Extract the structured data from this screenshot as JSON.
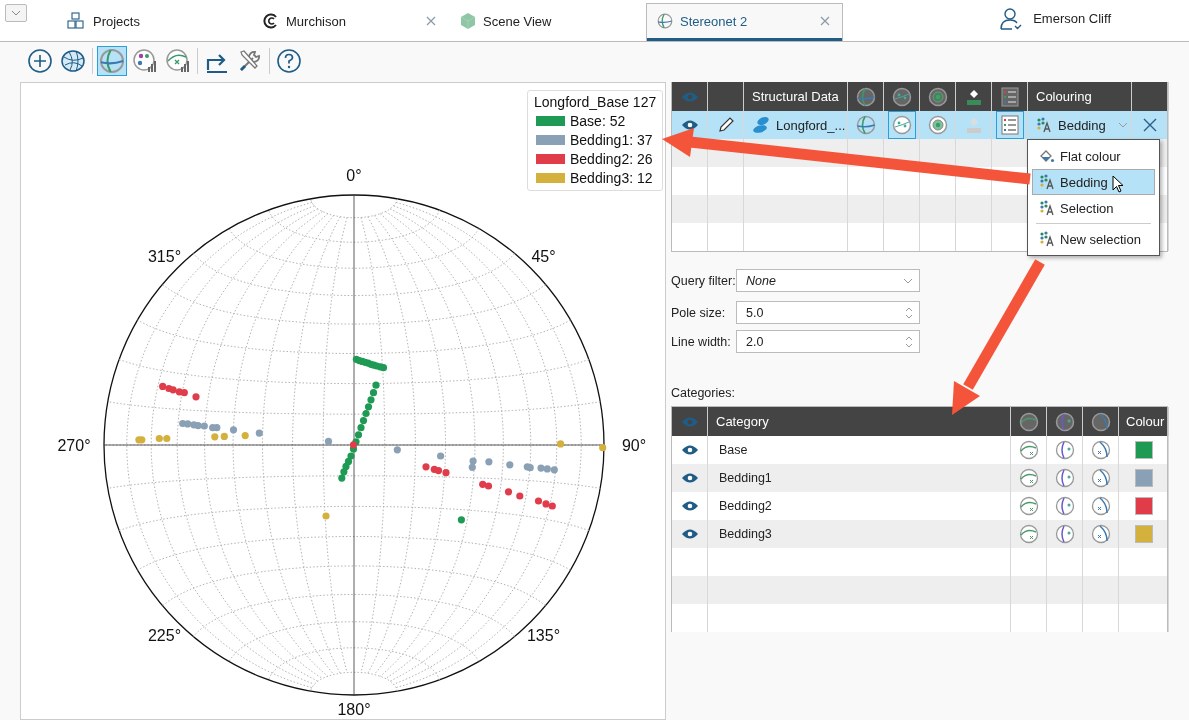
{
  "tab_bar": {
    "tabs": [
      {
        "label": "Projects",
        "kind": "projects",
        "selected": false,
        "closable": false
      },
      {
        "label": "Murchison",
        "kind": "project",
        "selected": false,
        "closable": true
      },
      {
        "label": "Scene View",
        "kind": "scene",
        "selected": false,
        "closable": false
      },
      {
        "label": "Stereonet 2",
        "kind": "stereonet",
        "selected": true,
        "closable": true
      }
    ],
    "user": {
      "name": "Emerson Cliff"
    }
  },
  "toolbar": [
    [
      {
        "kind": "add",
        "selected": false
      },
      {
        "kind": "mesh",
        "selected": false
      }
    ],
    [
      {
        "kind": "stereonet",
        "selected": true
      },
      {
        "kind": "palette",
        "selected": false
      },
      {
        "kind": "chart",
        "selected": false
      }
    ],
    [
      {
        "kind": "export",
        "selected": false
      },
      {
        "kind": "tools",
        "selected": false
      }
    ],
    [
      {
        "kind": "help",
        "selected": false
      }
    ]
  ],
  "stereonet": {
    "legend": {
      "title": "Longford_Base 127",
      "items": [
        {
          "label": "Base: 52",
          "color": "#1f9a55"
        },
        {
          "label": "Bedding1: 37",
          "color": "#8aa0b4"
        },
        {
          "label": "Bedding2: 26",
          "color": "#e03c4a"
        },
        {
          "label": "Bedding3: 12",
          "color": "#d4b03c"
        }
      ]
    },
    "direction_labels": [
      "0°",
      "45°",
      "90°",
      "135°",
      "180°",
      "225°",
      "270°",
      "315°"
    ]
  },
  "layers_table": {
    "columns": [
      {
        "kind": "eye"
      },
      {
        "kind": "blank"
      },
      {
        "kind": "text",
        "label": "Structural Data"
      },
      {
        "kind": "globe"
      },
      {
        "kind": "poles"
      },
      {
        "kind": "contours"
      },
      {
        "kind": "paint"
      },
      {
        "kind": "legend"
      },
      {
        "kind": "text",
        "label": "Colouring"
      },
      {
        "kind": "blank"
      }
    ],
    "rows": [
      {
        "visible": true,
        "name": "Longford_...",
        "selected": true,
        "toggles": [
          false,
          true,
          false,
          false,
          true
        ],
        "colouring": "Bedding"
      }
    ]
  },
  "colour_menu": {
    "items": [
      {
        "label": "Flat colour",
        "kind": "flat",
        "selected": false
      },
      {
        "label": "Bedding",
        "kind": "category",
        "selected": true
      },
      {
        "label": "Selection",
        "kind": "category",
        "selected": false
      },
      {
        "label": "New selection",
        "kind": "new",
        "selected": false
      }
    ]
  },
  "options": {
    "query_filter": {
      "label": "Query filter:",
      "value": "None"
    },
    "pole_size": {
      "label": "Pole size:",
      "value": "5.0"
    },
    "line_width": {
      "label": "Line width:",
      "value": "2.0"
    }
  },
  "categories": {
    "label": "Categories:",
    "columns": [
      {
        "kind": "eye"
      },
      {
        "kind": "text",
        "label": "Category"
      },
      {
        "kind": "planes"
      },
      {
        "kind": "plane-pole"
      },
      {
        "kind": "pole"
      },
      {
        "kind": "text",
        "label": "Colour"
      }
    ],
    "rows": [
      {
        "name": "Base",
        "visible": true,
        "color": "#1f9a55"
      },
      {
        "name": "Bedding1",
        "visible": true,
        "color": "#8aa0b4"
      },
      {
        "name": "Bedding2",
        "visible": true,
        "color": "#e03c4a"
      },
      {
        "name": "Bedding3",
        "visible": true,
        "color": "#d4b03c"
      }
    ]
  }
}
